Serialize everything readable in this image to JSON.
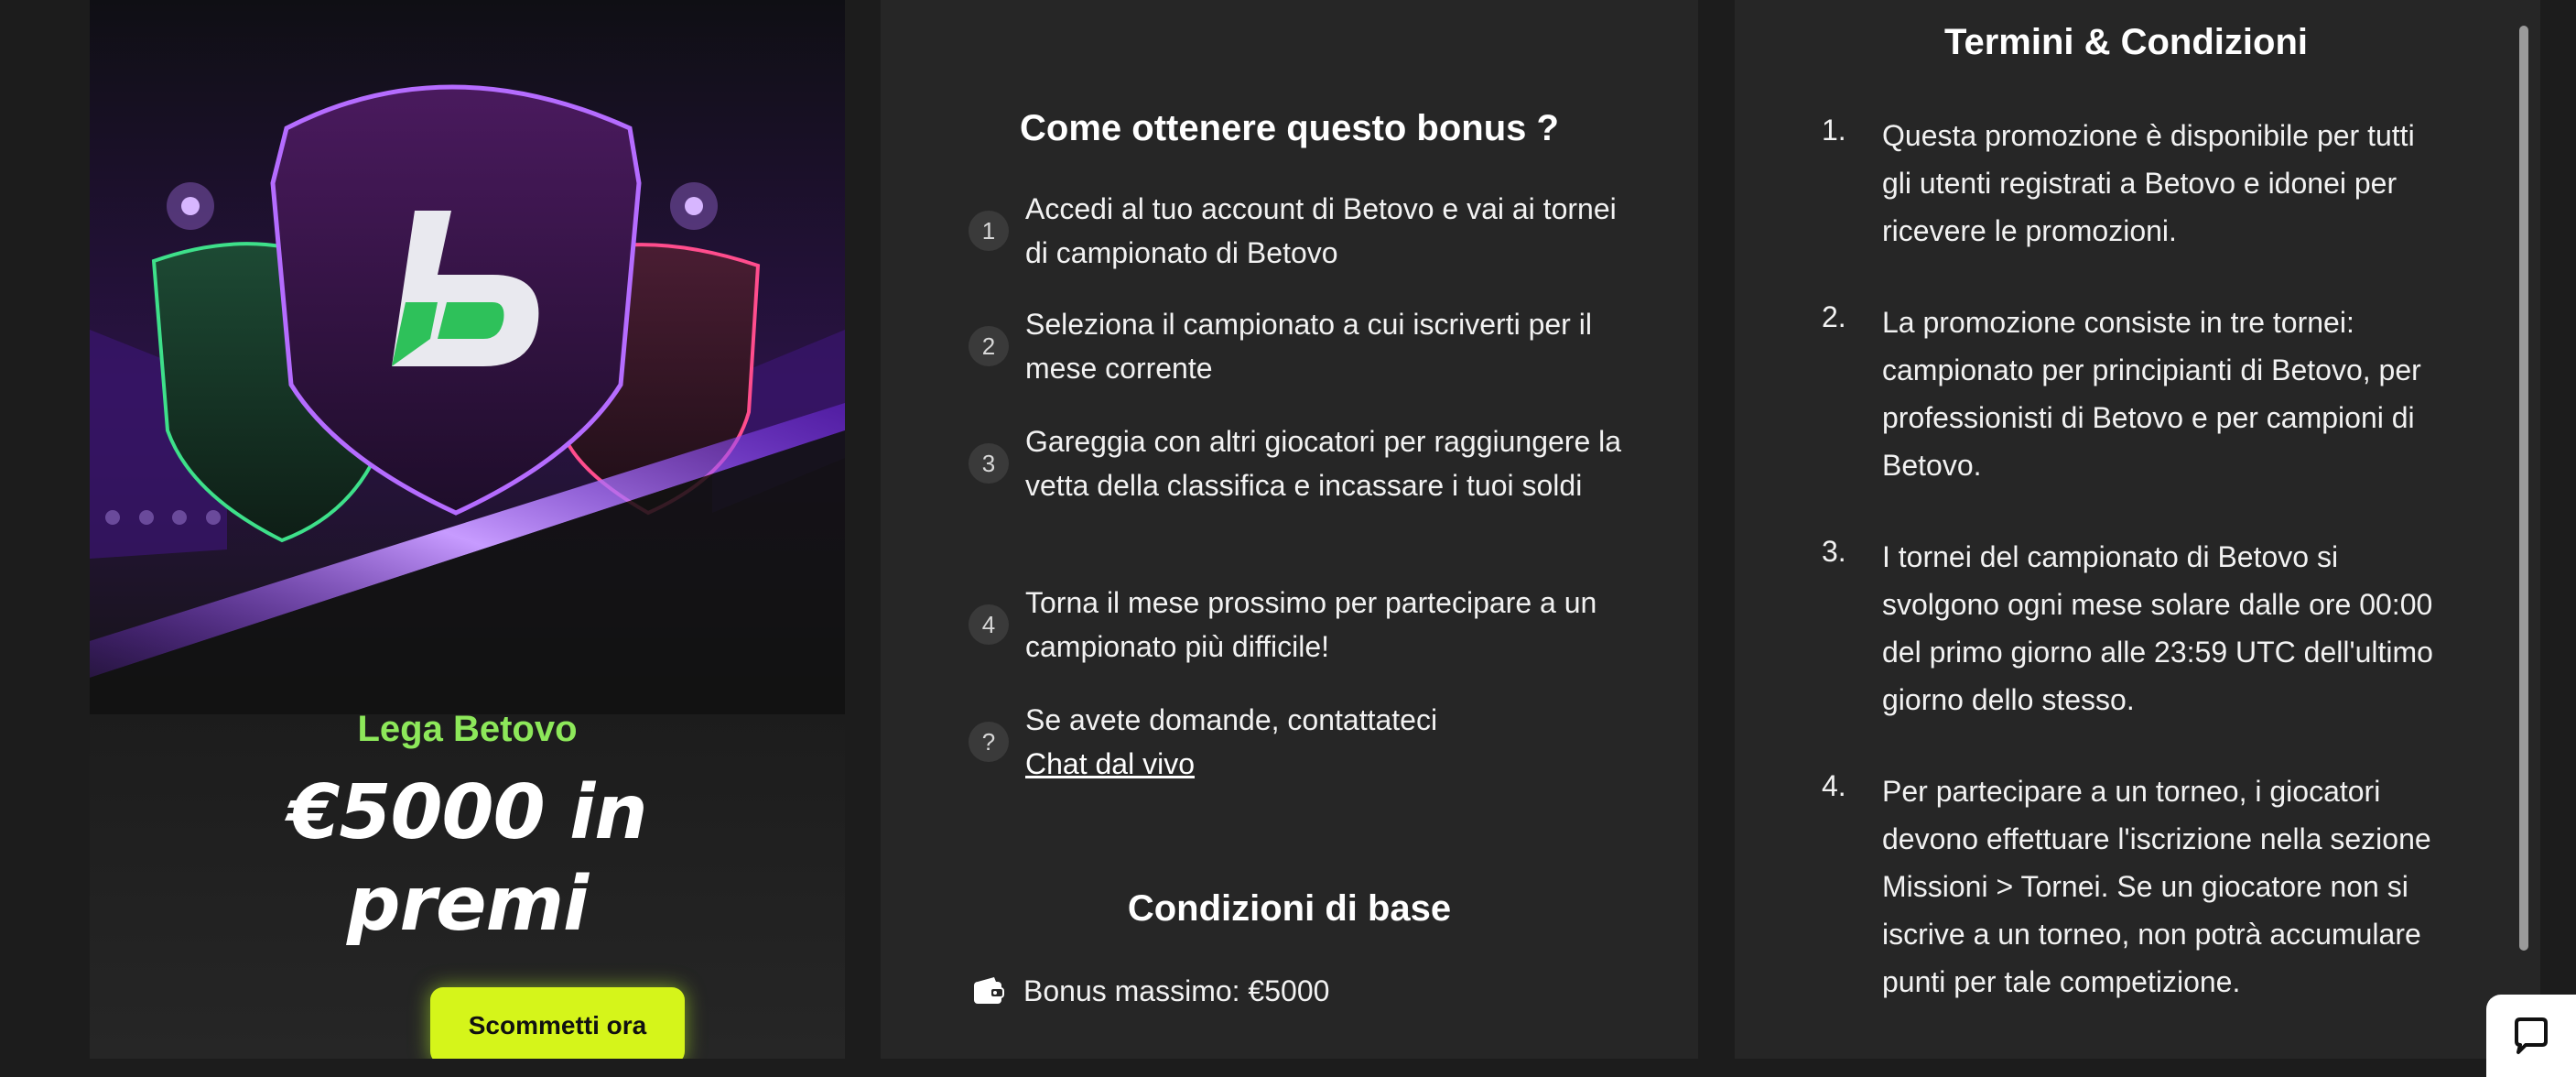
{
  "promo": {
    "brand": "Lega Betovo",
    "prize_line1": "€5000 in",
    "prize_line2": "premi",
    "cta_label": "Scommetti ora",
    "colors": {
      "brand": "#8de85a",
      "cta": "#d5f51a",
      "accent_purple": "#7b2cff"
    }
  },
  "how": {
    "title": "Come ottenere questo bonus ?",
    "steps": [
      {
        "num": "1",
        "text": "Accedi al tuo account di Betovo e vai ai tornei di campionato di Betovo"
      },
      {
        "num": "2",
        "text": "Seleziona il campionato a cui iscriverti per il mese corrente"
      },
      {
        "num": "3",
        "text": "Gareggia con altri giocatori per raggiungere la vetta della classifica e incassare i tuoi soldi"
      },
      {
        "num": "4",
        "text": "Torna il mese prossimo per partecipare a un campionato più difficile!"
      }
    ],
    "help": {
      "num": "?",
      "text": "Se avete domande, contattateci",
      "link": "Chat dal vivo"
    },
    "base_title": "Condizioni di base",
    "base_item": "Bonus massimo: €5000"
  },
  "terms": {
    "title": "Termini & Condizioni",
    "items": [
      {
        "num": "1.",
        "text": "Questa promozione è disponibile per tutti gli utenti registrati a Betovo e idonei per ricevere le promozioni."
      },
      {
        "num": "2.",
        "text": "La promozione consiste in tre tornei: campionato per principianti di Betovo, per professionisti di Betovo e per campioni di Betovo."
      },
      {
        "num": "3.",
        "text": "I tornei del campionato di Betovo si svolgono ogni mese solare dalle ore 00:00 del primo giorno alle 23:59 UTC dell'ultimo giorno dello stesso."
      },
      {
        "num": "4.",
        "text": "Per partecipare a un torneo, i giocatori devono effettuare l'iscrizione nella sezione Missioni > Tornei. Se un giocatore non si iscrive a un torneo, non potrà accumulare punti per tale competizione."
      }
    ]
  },
  "icons": {
    "wallet": "wallet-icon",
    "chat": "chat-bubble-icon",
    "shield": "shield-logo-icon"
  }
}
